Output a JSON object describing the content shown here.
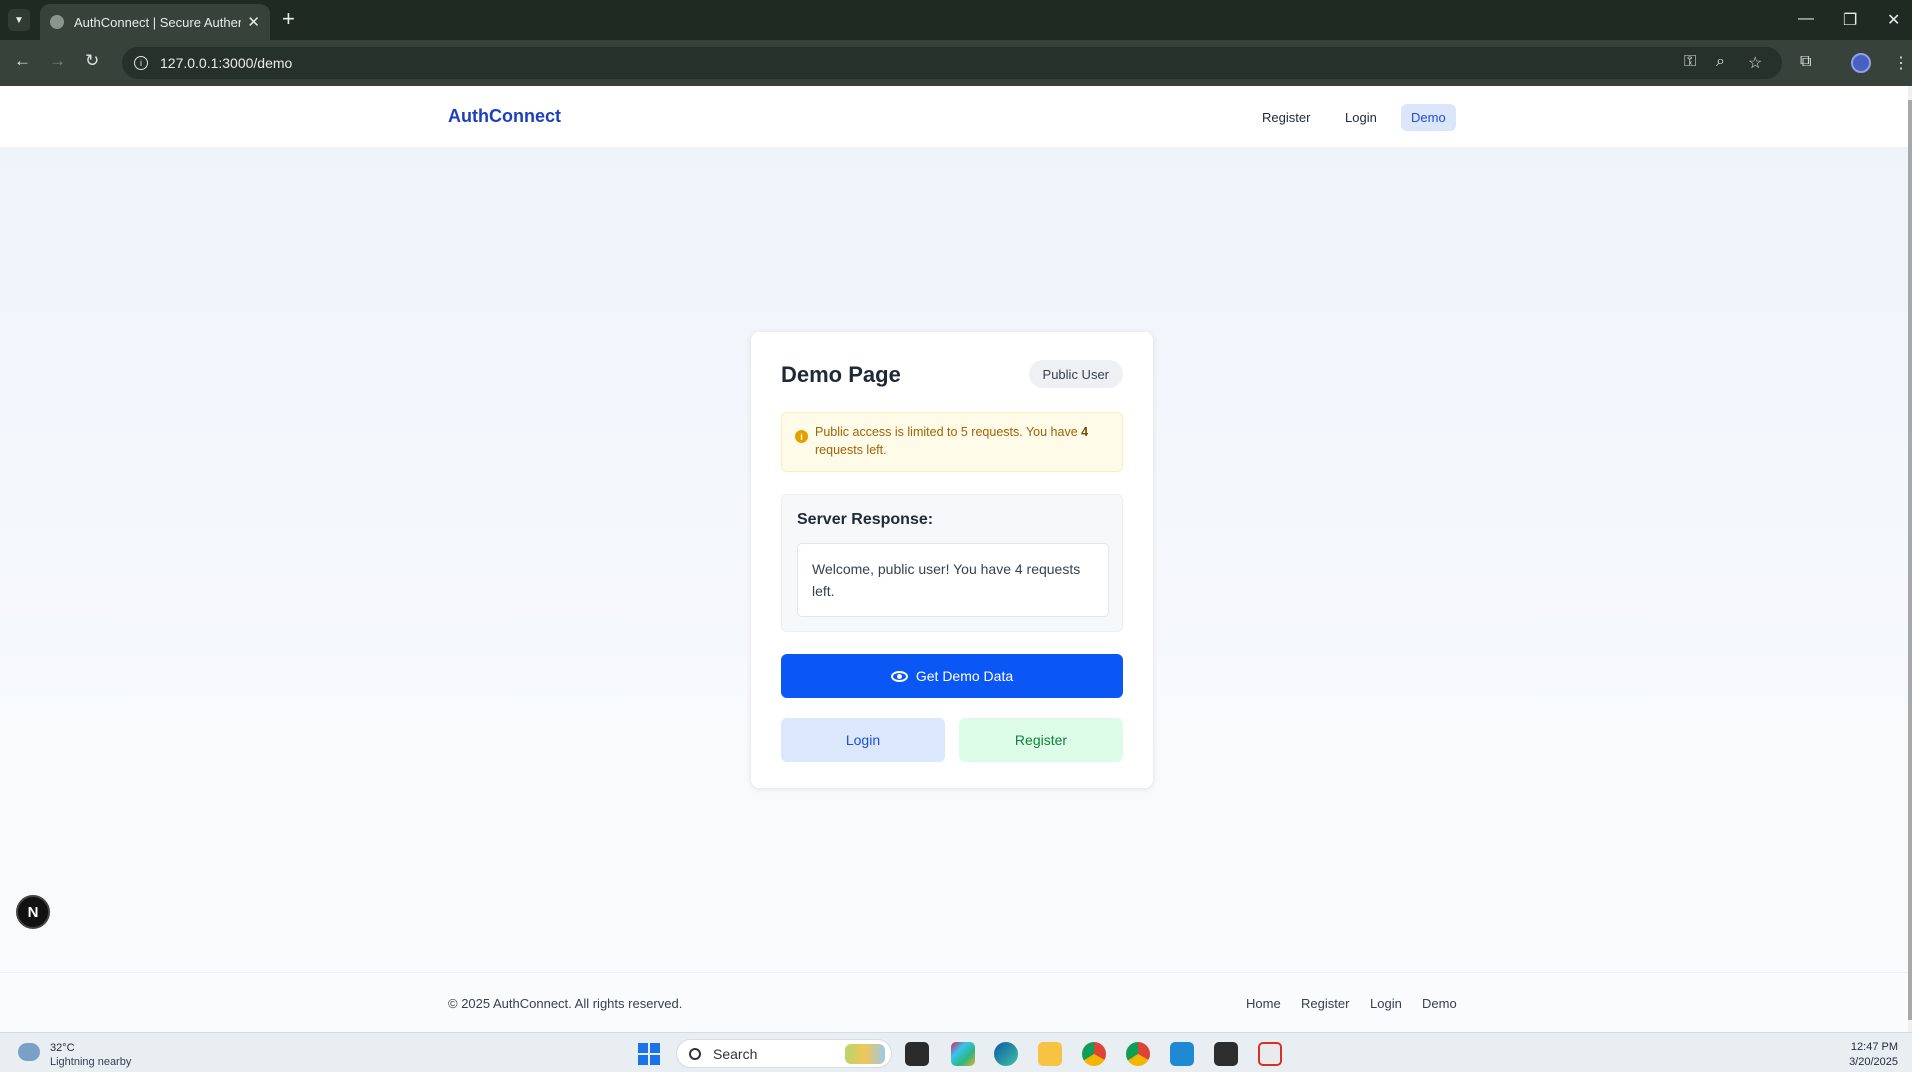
{
  "browser": {
    "tab_title": "AuthConnect | Secure Authenti",
    "url": "127.0.0.1:3000/demo",
    "new_tab": "+",
    "tab_close": "✕"
  },
  "header": {
    "brand": "AuthConnect",
    "nav": {
      "register": "Register",
      "login": "Login",
      "demo": "Demo"
    }
  },
  "card": {
    "title": "Demo Page",
    "badge": "Public User",
    "alert": {
      "prefix": "Public access is limited to 5 requests. You have ",
      "count": "4",
      "suffix": " requests left."
    },
    "response_title": "Server Response:",
    "response_text": "Welcome, public user! You have 4 requests left.",
    "primary_button": "Get Demo Data",
    "login_button": "Login",
    "register_button": "Register"
  },
  "footer": {
    "copyright": "© 2025 AuthConnect. All rights reserved.",
    "links": {
      "home": "Home",
      "register": "Register",
      "login": "Login",
      "demo": "Demo"
    }
  },
  "next_badge": "N",
  "taskbar": {
    "weather_temp": "32°C",
    "weather_desc": "Lightning nearby",
    "search": "Search",
    "time": "12:47 PM",
    "date": "3/20/2025"
  },
  "colors": {
    "brand": "#1d3fbf",
    "primary": "#0b57f5",
    "alert_bg": "#fefbe8",
    "login_bg": "#dbe7fb",
    "register_bg": "#dcfce7"
  }
}
